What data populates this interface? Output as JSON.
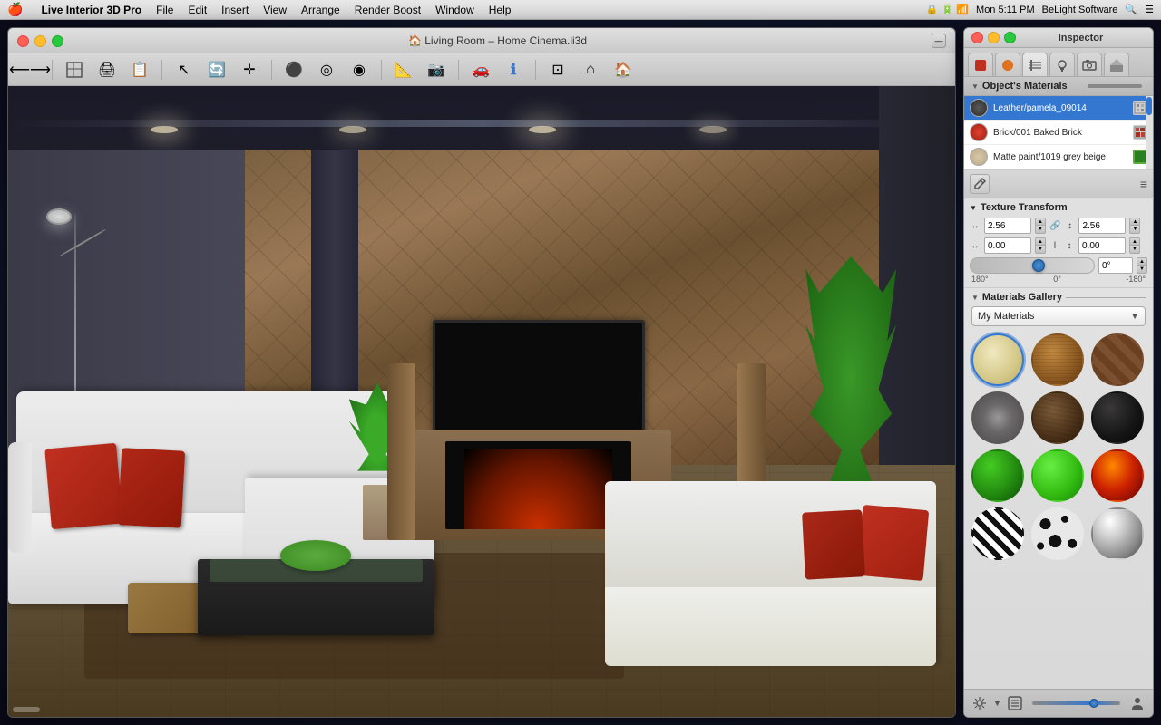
{
  "menubar": {
    "apple": "🍎",
    "items": [
      "Live Interior 3D Pro",
      "File",
      "Edit",
      "Insert",
      "View",
      "Arrange",
      "Render Boost",
      "Window",
      "Help"
    ],
    "right": {
      "time": "Mon 5:11 PM",
      "brand": "BeLight Software"
    }
  },
  "window": {
    "title": "🏠 Living Room – Home Cinema.li3d",
    "traffic_lights": {
      "close_color": "#ff5f56",
      "minimize_color": "#ffbd2e",
      "maximize_color": "#27c93f"
    }
  },
  "toolbar": {
    "tools": [
      "←→",
      "⊞",
      "⊟",
      "⊠",
      "↖",
      "⟳",
      "⊹",
      "●",
      "◎",
      "◉",
      "⚔",
      "📷",
      "🚗",
      "ℹ",
      "⊡",
      "🏠",
      "⌂"
    ]
  },
  "inspector": {
    "title": "Inspector",
    "traffic": {
      "close": "#ff5f56",
      "minimize": "#ffbd2e",
      "maximize": "#27c93f"
    },
    "tabs": [
      "🔴",
      "🟠",
      "✏️",
      "⚫",
      "💡",
      "🏠"
    ],
    "active_tab": 2,
    "objects_materials_label": "Object's Materials",
    "materials": [
      {
        "name": "Leather/pamela_09014",
        "swatch_color": "#3a3a3a",
        "selected": true
      },
      {
        "name": "Brick/001 Baked Brick",
        "swatch_color": "#c03020",
        "selected": false
      },
      {
        "name": "Matte paint/1019 grey beige",
        "swatch_color": "#c8b898",
        "selected": false
      }
    ],
    "texture_transform": {
      "label": "Texture Transform",
      "scale_x": "2.56",
      "scale_y": "2.56",
      "offset_x": "0.00",
      "offset_y": "0.00",
      "angle": "0°",
      "angle_min": "180°",
      "angle_mid": "0°",
      "angle_max": "-180°"
    },
    "gallery": {
      "label": "Materials Gallery",
      "dropdown_value": "My Materials",
      "swatches": [
        {
          "id": 1,
          "color": "#e8d8a0",
          "type": "light_fabric",
          "selected": true
        },
        {
          "id": 2,
          "color": "#8a6030",
          "type": "wood_light",
          "selected": false
        },
        {
          "id": 3,
          "color": "#7a5028",
          "type": "wood_dark_brick",
          "selected": false
        },
        {
          "id": 4,
          "color": "#888888",
          "type": "concrete",
          "selected": false
        },
        {
          "id": 5,
          "color": "#5a3a20",
          "type": "dark_wood",
          "selected": false
        },
        {
          "id": 6,
          "color": "#1a1a1a",
          "type": "black_material",
          "selected": false
        },
        {
          "id": 7,
          "color": "#22aa22",
          "type": "green_matte",
          "selected": false
        },
        {
          "id": 8,
          "color": "#33cc33",
          "type": "green_bright",
          "selected": false
        },
        {
          "id": 9,
          "color": "#cc2200",
          "type": "fire_red",
          "selected": false
        },
        {
          "id": 10,
          "color": "#dddddd",
          "type": "zebra",
          "selected": false
        },
        {
          "id": 11,
          "color": "#dddddd",
          "type": "dalmatian",
          "selected": false
        },
        {
          "id": 12,
          "color": "#cccccc",
          "type": "metallic",
          "selected": false
        }
      ]
    },
    "bottom_bar": {
      "add_icon": "⚙",
      "export_icon": "⊞",
      "person_icon": "👤"
    }
  }
}
